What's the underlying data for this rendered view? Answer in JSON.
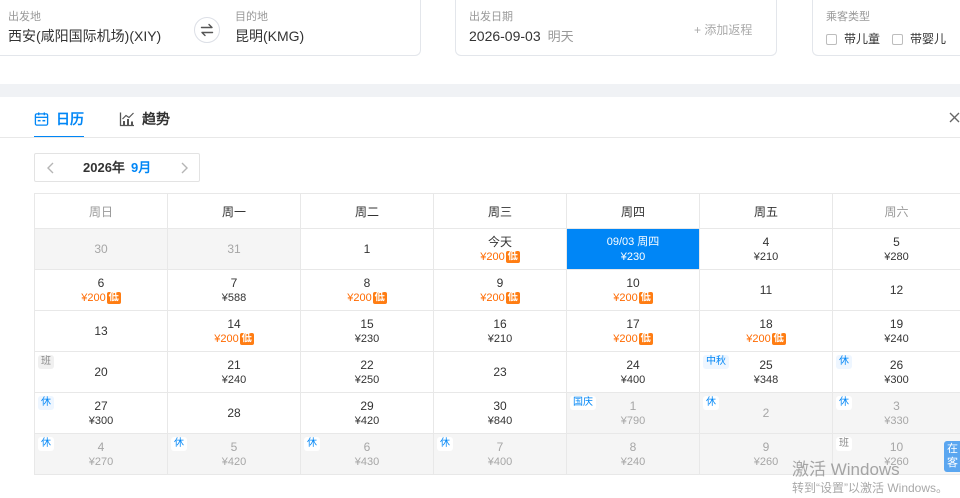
{
  "colors": {
    "accent": "#0086f6",
    "low_price": "#ff6a00",
    "low_badge_bg": "#ff7d13",
    "muted_cell_bg": "#f5f5f5",
    "float_button_bg": "#5aa6f0"
  },
  "search": {
    "from_label": "出发地",
    "from_value": "西安(咸阳国际机场)(XIY)",
    "to_label": "目的地",
    "to_value": "昆明(KMG)",
    "date_label": "出发日期",
    "date_value": "2026-09-03",
    "date_hint": "明天",
    "add_return": "+ 添加返程",
    "passenger_label": "乘客类型",
    "passenger_options": [
      {
        "label": "带儿童",
        "checked": false
      },
      {
        "label": "带婴儿",
        "checked": false
      }
    ]
  },
  "tabs": [
    {
      "label": "日历",
      "icon": "calendar-icon",
      "active": true
    },
    {
      "label": "趋势",
      "icon": "trend-chart-icon",
      "active": false
    }
  ],
  "month_nav": {
    "year": "2026年",
    "month": "9月"
  },
  "calendar": {
    "low_badge": "低",
    "weekdays": [
      {
        "label": "周日",
        "weekend": true
      },
      {
        "label": "周一",
        "weekend": false
      },
      {
        "label": "周二",
        "weekend": false
      },
      {
        "label": "周三",
        "weekend": false
      },
      {
        "label": "周四",
        "weekend": false
      },
      {
        "label": "周五",
        "weekend": false
      },
      {
        "label": "周六",
        "weekend": true
      }
    ],
    "rows": [
      [
        {
          "day": "30",
          "muted": true
        },
        {
          "day": "31",
          "muted": true
        },
        {
          "day": "1"
        },
        {
          "day": "今天",
          "price": "¥200",
          "low": true
        },
        {
          "day": "09/03 周四",
          "price": "¥230",
          "selected": true
        },
        {
          "day": "4",
          "price": "¥210"
        },
        {
          "day": "5",
          "price": "¥280"
        }
      ],
      [
        {
          "day": "6",
          "price": "¥200",
          "low": true
        },
        {
          "day": "7",
          "price": "¥588"
        },
        {
          "day": "8",
          "price": "¥200",
          "low": true
        },
        {
          "day": "9",
          "price": "¥200",
          "low": true
        },
        {
          "day": "10",
          "price": "¥200",
          "low": true
        },
        {
          "day": "11"
        },
        {
          "day": "12"
        }
      ],
      [
        {
          "day": "13"
        },
        {
          "day": "14",
          "price": "¥200",
          "low": true
        },
        {
          "day": "15",
          "price": "¥230"
        },
        {
          "day": "16",
          "price": "¥210"
        },
        {
          "day": "17",
          "price": "¥200",
          "low": true
        },
        {
          "day": "18",
          "price": "¥200",
          "low": true
        },
        {
          "day": "19",
          "price": "¥240"
        }
      ],
      [
        {
          "day": "20",
          "tag": "班",
          "tag_type": "workday"
        },
        {
          "day": "21",
          "price": "¥240"
        },
        {
          "day": "22",
          "price": "¥250"
        },
        {
          "day": "23"
        },
        {
          "day": "24",
          "price": "¥400"
        },
        {
          "day": "25",
          "price": "¥348",
          "tag": "中秋",
          "tag_type": "holiday"
        },
        {
          "day": "26",
          "price": "¥300",
          "tag": "休",
          "tag_type": "holiday"
        }
      ],
      [
        {
          "day": "27",
          "price": "¥300",
          "tag": "休",
          "tag_type": "holiday"
        },
        {
          "day": "28"
        },
        {
          "day": "29",
          "price": "¥420"
        },
        {
          "day": "30",
          "price": "¥840"
        },
        {
          "day": "1",
          "price": "¥790",
          "tag": "国庆",
          "tag_type": "holiday",
          "muted": true
        },
        {
          "day": "2",
          "tag": "休",
          "tag_type": "holiday",
          "muted": true
        },
        {
          "day": "3",
          "price": "¥330",
          "tag": "休",
          "tag_type": "holiday",
          "muted": true
        }
      ],
      [
        {
          "day": "4",
          "price": "¥270",
          "tag": "休",
          "tag_type": "holiday",
          "muted": true
        },
        {
          "day": "5",
          "price": "¥420",
          "tag": "休",
          "tag_type": "holiday",
          "muted": true
        },
        {
          "day": "6",
          "price": "¥430",
          "tag": "休",
          "tag_type": "holiday",
          "muted": true
        },
        {
          "day": "7",
          "price": "¥400",
          "tag": "休",
          "tag_type": "holiday",
          "muted": true
        },
        {
          "day": "8",
          "price": "¥240",
          "muted": true
        },
        {
          "day": "9",
          "price": "¥260",
          "muted": true
        },
        {
          "day": "10",
          "price": "¥260",
          "tag": "班",
          "tag_type": "workday",
          "muted": true
        }
      ]
    ]
  },
  "float_button": {
    "lines": [
      "在",
      "客"
    ]
  },
  "watermark": {
    "title": "激活 Windows",
    "subtitle": "转到“设置”以激活 Windows。"
  }
}
